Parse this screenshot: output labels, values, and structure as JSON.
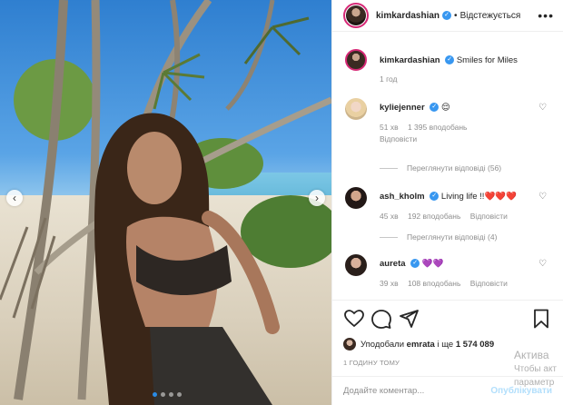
{
  "post": {
    "author": "kimkardashian",
    "follow_status": "Відстежується",
    "more_glyph": "•••",
    "separator": "•"
  },
  "caption": {
    "user": "kimkardashian",
    "text": "Smiles for Miles",
    "time": "1 год"
  },
  "comments": [
    {
      "user": "kyliejenner",
      "text": "😌",
      "time": "51 хв",
      "likes": "1 395 вподобань",
      "reply": "Відповісти",
      "view_replies": "Переглянути відповіді (56)"
    },
    {
      "user": "ash_kholm",
      "text": "Living life !!❤️❤️❤️",
      "time": "45 хв",
      "likes": "192 вподобань",
      "reply": "Відповісти",
      "view_replies": "Переглянути відповіді (4)"
    },
    {
      "user": "aureta",
      "text": "💜💜",
      "time": "39 хв",
      "likes": "108 вподобань",
      "reply": "Відповісти"
    }
  ],
  "likes": {
    "prefix": "Уподобали",
    "user": "emrata",
    "middle": "і ще",
    "count": "1 574 089"
  },
  "posted_ago": "1 ГОДИНУ ТОМУ",
  "comment_input": {
    "placeholder": "Додайте коментар...",
    "post_label": "Опублікувати"
  },
  "watermark": {
    "line1": "Актива",
    "line2": "Чтобы акт",
    "line3": "параметр"
  },
  "carousel": {
    "total": 4,
    "active": 0,
    "prev": "‹",
    "next": "›"
  },
  "colors": {
    "verified": "#3897f0",
    "active_dot": "#2a8be6",
    "ring": "#d62976"
  },
  "icons": [
    "more-icon",
    "heart-icon",
    "comment-icon",
    "share-icon",
    "bookmark-icon",
    "verified-icon"
  ]
}
